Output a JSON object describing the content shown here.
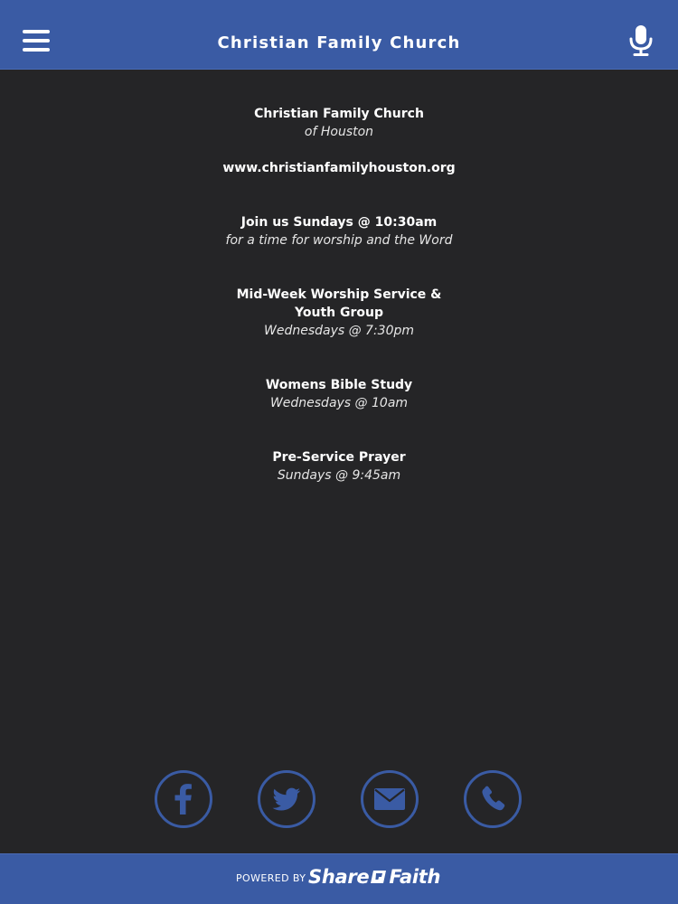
{
  "header": {
    "title": "Christian Family Church",
    "menu_icon": "hamburger-menu-icon",
    "mic_icon": "microphone-icon",
    "background_color": "#3a5ba4"
  },
  "content": {
    "church_name": "Christian Family Church",
    "church_location": "of Houston",
    "website": "www.christianfamilyhouston.org",
    "events": [
      {
        "title_line1": "Join us Sundays @ 10:30am",
        "title_line2": "",
        "subtitle": "for a time for worship and the Word"
      },
      {
        "title_line1": "Mid-Week Worship Service &",
        "title_line2": "Youth Group",
        "subtitle": "Wednesdays @ 7:30pm"
      },
      {
        "title_line1": "Womens Bible Study",
        "title_line2": "",
        "subtitle": "Wednesdays @ 10am"
      },
      {
        "title_line1": "Pre-Service Prayer",
        "title_line2": "",
        "subtitle": "Sundays @ 9:45am"
      }
    ]
  },
  "social": [
    {
      "icon": "facebook-icon"
    },
    {
      "icon": "twitter-icon"
    },
    {
      "icon": "email-icon"
    },
    {
      "icon": "phone-icon"
    }
  ],
  "footer": {
    "powered_by": "POWERED BY",
    "brand_part1": "Share",
    "brand_part2": "Faith"
  },
  "colors": {
    "accent": "#3a5ba4",
    "background": "#252527",
    "text": "#ffffff"
  }
}
